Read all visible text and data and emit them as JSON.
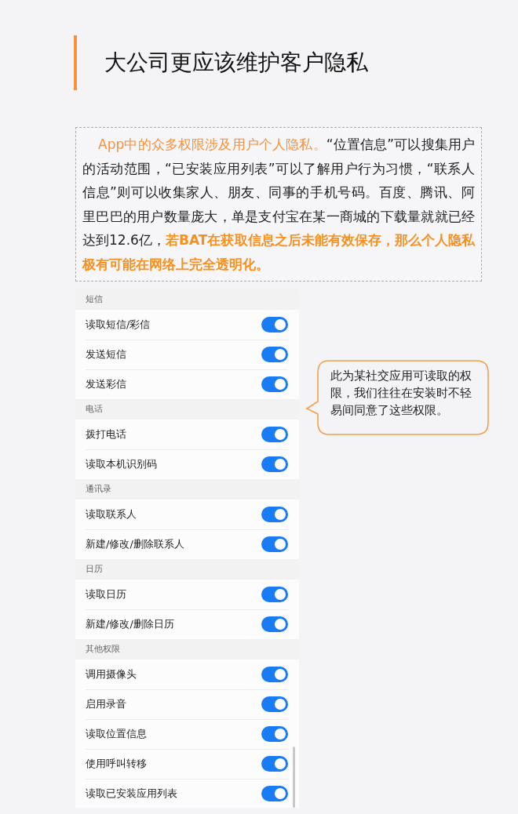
{
  "title": "大公司更应该维护客户隐私",
  "intro": [
    {
      "kind": "highlight",
      "text": "App中的众多权限涉及用户个人隐私。"
    },
    {
      "kind": "plain",
      "text": "“位置信息”可以搜集用户的活动范围，“已安装应用列表”可以了解用户行为习惯，“联系人信息”则可以收集家人、朋友、同事的手机号码。百度、腾讯、阿里巴巴的用户数量庞大，单是支付宝在某一商城的下载量就就已经达到12.6亿，"
    },
    {
      "kind": "emphasis",
      "text": "若BAT在获取信息之后未能有效保存，那么个人隐私极有可能在网络上完全透明化。"
    }
  ],
  "permissions": [
    {
      "section": "短信",
      "items": [
        {
          "label": "读取短信/彩信",
          "on": true
        },
        {
          "label": "发送短信",
          "on": true
        },
        {
          "label": "发送彩信",
          "on": true
        }
      ]
    },
    {
      "section": "电话",
      "items": [
        {
          "label": "拨打电话",
          "on": true
        },
        {
          "label": "读取本机识别码",
          "on": true
        }
      ]
    },
    {
      "section": "通讯录",
      "items": [
        {
          "label": "读取联系人",
          "on": true
        },
        {
          "label": "新建/修改/删除联系人",
          "on": true
        }
      ]
    },
    {
      "section": "日历",
      "items": [
        {
          "label": "读取日历",
          "on": true
        },
        {
          "label": "新建/修改/删除日历",
          "on": true
        }
      ]
    },
    {
      "section": "其他权限",
      "items": [
        {
          "label": "调用摄像头",
          "on": true
        },
        {
          "label": "启用录音",
          "on": true
        },
        {
          "label": "读取位置信息",
          "on": true
        },
        {
          "label": "使用呼叫转移",
          "on": true
        },
        {
          "label": "读取已安装应用列表",
          "on": true
        }
      ]
    }
  ],
  "callout": "此为某社交应用可读取的权限，我们往往在安装时不轻易间同意了这些权限。"
}
